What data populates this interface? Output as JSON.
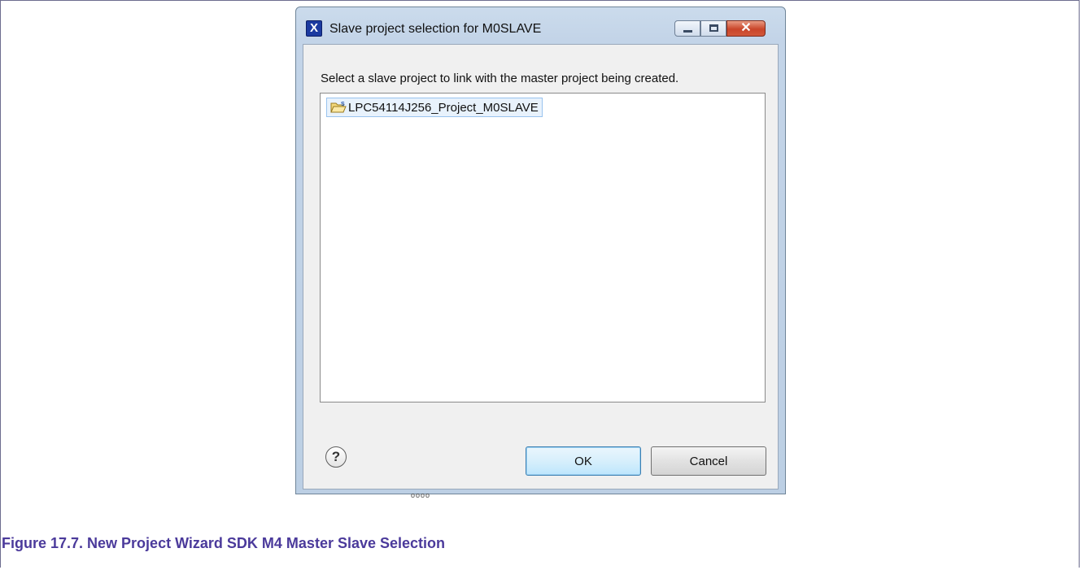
{
  "dialog": {
    "title": "Slave project selection for M0SLAVE",
    "app_icon_glyph": "X",
    "instruction": "Select a slave project to link with the master project being created.",
    "projects": [
      {
        "label": "LPC54114J256_Project_M0SLAVE",
        "icon": "project-folder-icon",
        "selected": true
      }
    ],
    "buttons": {
      "ok": "OK",
      "cancel": "Cancel"
    },
    "help_glyph": "?",
    "window_controls": {
      "close_glyph": "✕"
    }
  },
  "behind_text": "oooo",
  "caption": "Figure 17.7. New Project Wizard SDK M4 Master Slave Selection",
  "colors": {
    "caption": "#4b3a9b",
    "selection_fill": "#e8f2fc",
    "selection_border": "#99c3ee",
    "close_button": "#c9452a"
  }
}
